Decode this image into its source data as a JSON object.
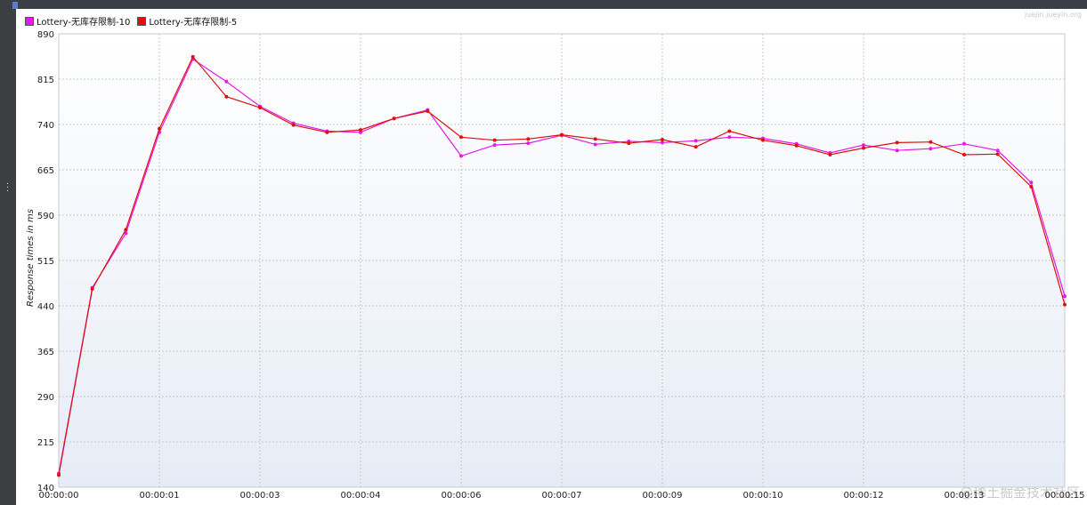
{
  "window": {
    "side_handle_icon": "vertical-dots-icon"
  },
  "legend": {
    "items": [
      {
        "label": "Lottery-无库存限制-10",
        "color": "#e619e6"
      },
      {
        "label": "Lottery-无库存限制-5",
        "color": "#dd1111"
      }
    ]
  },
  "watermarks": {
    "top_right": "juejin.jueyin.org",
    "bottom_right": "@稀土掘金技术社区"
  },
  "chart_data": {
    "type": "line",
    "title": "",
    "xlabel": "",
    "ylabel": "Response times in ms",
    "ylim": [
      140,
      890
    ],
    "yticks": [
      140,
      215,
      290,
      365,
      440,
      515,
      590,
      665,
      740,
      815,
      890
    ],
    "xlim": [
      0,
      15
    ],
    "xticks": [
      {
        "value": 0,
        "label": "00:00:00"
      },
      {
        "value": 1.5,
        "label": "00:00:01"
      },
      {
        "value": 3,
        "label": "00:00:03"
      },
      {
        "value": 4.5,
        "label": "00:00:04"
      },
      {
        "value": 6,
        "label": "00:00:06"
      },
      {
        "value": 7.5,
        "label": "00:00:07"
      },
      {
        "value": 9,
        "label": "00:00:09"
      },
      {
        "value": 10.5,
        "label": "00:00:10"
      },
      {
        "value": 12,
        "label": "00:00:12"
      },
      {
        "value": 13.5,
        "label": "00:00:13"
      },
      {
        "value": 15,
        "label": "00:00:15"
      }
    ],
    "grid": true,
    "legend_position": "top-left",
    "series": [
      {
        "name": "Lottery-无库存限制-10",
        "color": "#e619e6",
        "x": [
          0,
          0.5,
          1,
          1.5,
          2,
          2.5,
          3,
          3.5,
          4,
          4.5,
          5,
          5.5,
          6,
          6.5,
          7,
          7.5,
          8,
          8.5,
          9,
          9.5,
          10,
          10.5,
          11,
          11.5,
          12,
          12.5,
          13,
          13.5,
          14,
          14.5,
          15
        ],
        "values": [
          163,
          470,
          560,
          727,
          848,
          811,
          770,
          742,
          729,
          727,
          750,
          764,
          688,
          706,
          709,
          722,
          707,
          712,
          710,
          713,
          719,
          717,
          708,
          693,
          706,
          697,
          700,
          708,
          697,
          644,
          456
        ]
      },
      {
        "name": "Lottery-无库存限制-5",
        "color": "#dd1111",
        "x": [
          0,
          0.5,
          1,
          1.5,
          2,
          2.5,
          3,
          3.5,
          4,
          4.5,
          5,
          5.5,
          6,
          6.5,
          7,
          7.5,
          8,
          8.5,
          9,
          9.5,
          10,
          10.5,
          11,
          11.5,
          12,
          12.5,
          13,
          13.5,
          14,
          14.5,
          15
        ],
        "values": [
          160,
          468,
          566,
          733,
          852,
          786,
          768,
          739,
          727,
          731,
          750,
          762,
          719,
          714,
          716,
          723,
          716,
          709,
          715,
          703,
          729,
          714,
          705,
          690,
          701,
          710,
          711,
          690,
          691,
          637,
          442
        ]
      }
    ]
  }
}
